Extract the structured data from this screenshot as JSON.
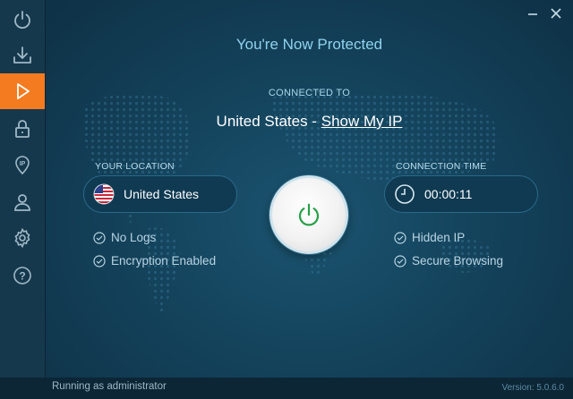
{
  "window": {
    "minimize_icon": "minimize-icon",
    "close_icon": "close-icon"
  },
  "sidebar": {
    "items": [
      {
        "name": "power",
        "icon": "power-icon",
        "active": false
      },
      {
        "name": "download",
        "icon": "download-icon",
        "active": false
      },
      {
        "name": "play",
        "icon": "play-icon",
        "active": true
      },
      {
        "name": "lock",
        "icon": "lock-icon",
        "active": false
      },
      {
        "name": "ip",
        "icon": "ip-pin-icon",
        "active": false
      },
      {
        "name": "account",
        "icon": "user-icon",
        "active": false
      },
      {
        "name": "settings",
        "icon": "gear-icon",
        "active": false
      },
      {
        "name": "help",
        "icon": "help-icon",
        "active": false
      }
    ],
    "active_color": "#f47b20"
  },
  "main": {
    "title": "You're Now Protected",
    "connected_label": "CONNECTED TO",
    "connected_country": "United States -",
    "show_ip_link": "Show My IP",
    "location": {
      "label": "YOUR LOCATION",
      "value": "United States",
      "flag_icon": "us-flag-icon"
    },
    "connection_time": {
      "label": "CONNECTION TIME",
      "value": "00:00:11",
      "clock_icon": "clock-icon"
    },
    "features_left": [
      {
        "label": "No Logs"
      },
      {
        "label": "Encryption Enabled"
      }
    ],
    "features_right": [
      {
        "label": "Hidden IP"
      },
      {
        "label": "Secure Browsing"
      }
    ],
    "power_button_icon": "power-icon",
    "power_color": "#2aa14a"
  },
  "footer": {
    "status": "Running as administrator",
    "version": "Version: 5.0.6.0"
  }
}
